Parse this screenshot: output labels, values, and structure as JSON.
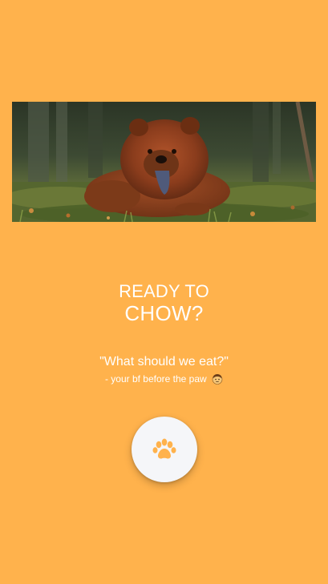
{
  "colors": {
    "background": "#FFB24C",
    "button_bg": "#F5F6F9",
    "paw_icon": "#FFB24C",
    "text": "#FFFFFF"
  },
  "hero_image": {
    "icon": "dog-photo"
  },
  "headline": {
    "line1": "READY TO",
    "line2": "CHOW?"
  },
  "quote": {
    "text": "\"What should we eat?\"",
    "attribution": "- your bf before the paw"
  },
  "attribution_emoji": {
    "icon": "boy-face-emoji"
  },
  "action_button": {
    "icon": "paw-icon"
  }
}
